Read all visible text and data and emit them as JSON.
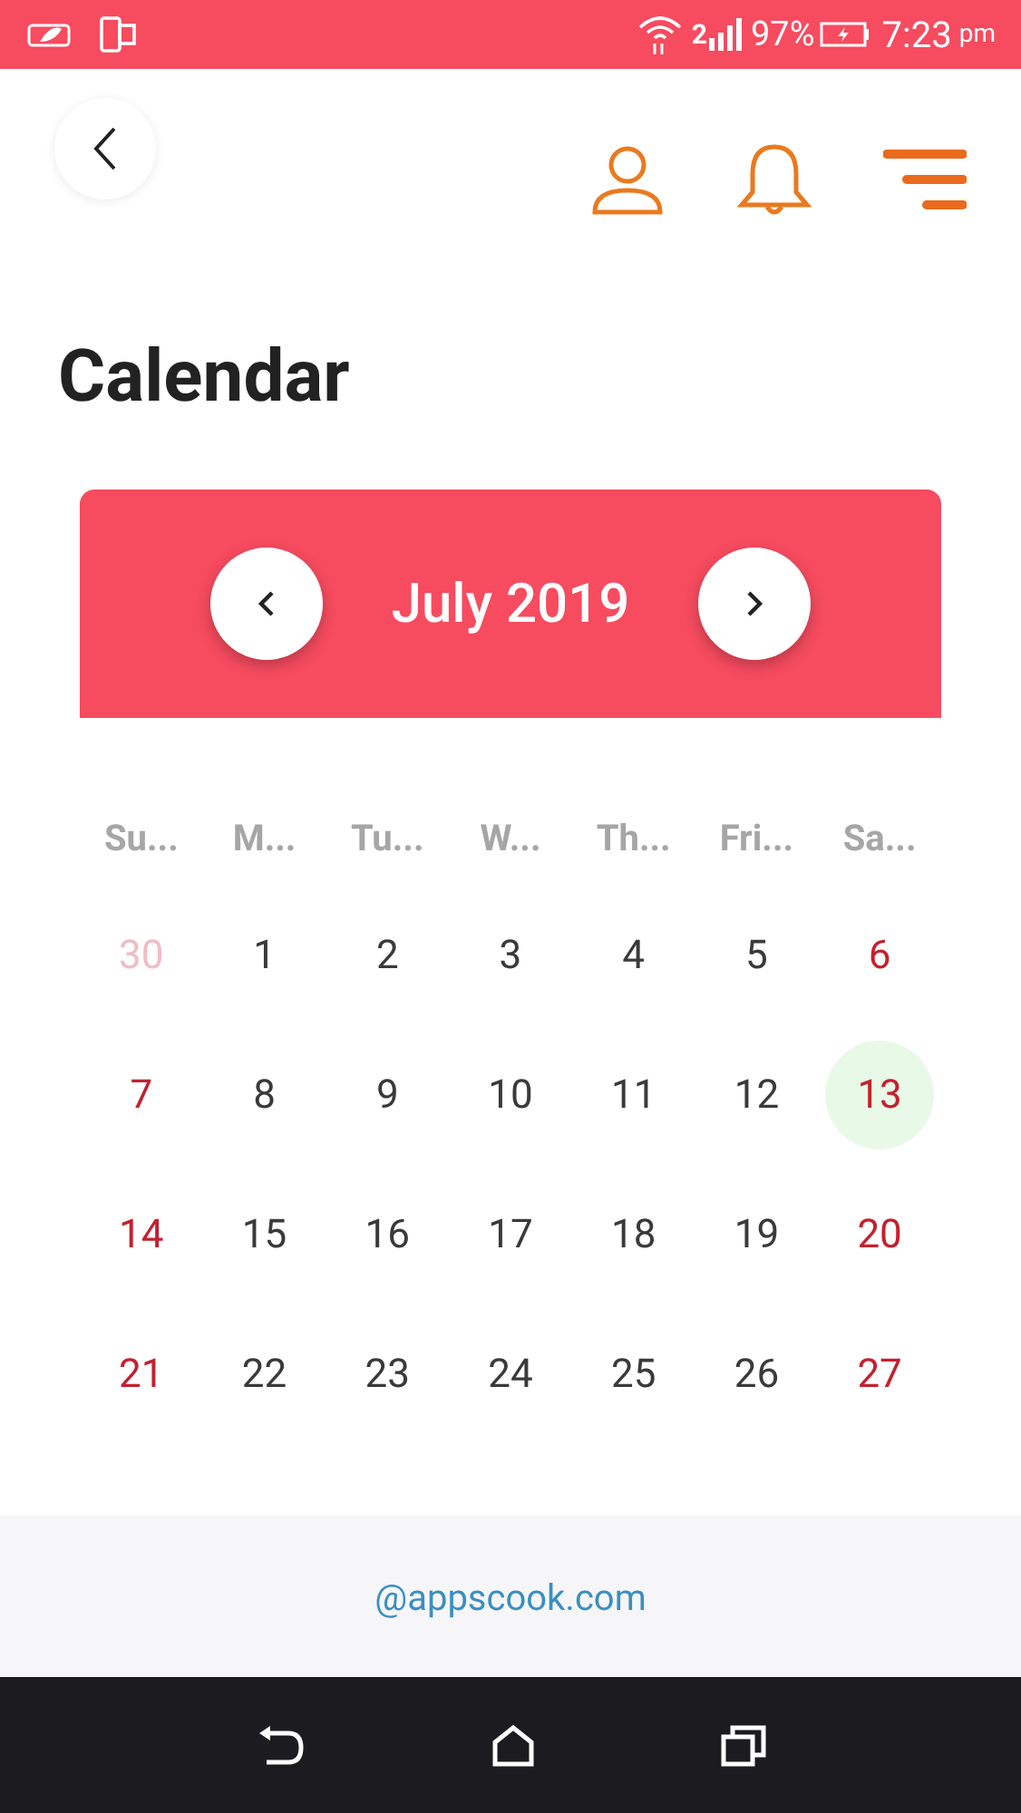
{
  "status_bar": {
    "network": "2",
    "battery": "97%",
    "time": "7:23",
    "ampm": "pm"
  },
  "page": {
    "title": "Calendar"
  },
  "calendar": {
    "month": "July 2019",
    "weekdays": [
      "Su...",
      "M...",
      "Tu...",
      "W...",
      "Th...",
      "Fri...",
      "Sa..."
    ],
    "days": [
      {
        "label": "30",
        "kind": "outside",
        "selected": false
      },
      {
        "label": "1",
        "kind": "weekday",
        "selected": false
      },
      {
        "label": "2",
        "kind": "weekday",
        "selected": false
      },
      {
        "label": "3",
        "kind": "weekday",
        "selected": false
      },
      {
        "label": "4",
        "kind": "weekday",
        "selected": false
      },
      {
        "label": "5",
        "kind": "weekday",
        "selected": false
      },
      {
        "label": "6",
        "kind": "weekend",
        "selected": false
      },
      {
        "label": "7",
        "kind": "weekend",
        "selected": false
      },
      {
        "label": "8",
        "kind": "weekday",
        "selected": false
      },
      {
        "label": "9",
        "kind": "weekday",
        "selected": false
      },
      {
        "label": "10",
        "kind": "weekday",
        "selected": false
      },
      {
        "label": "11",
        "kind": "weekday",
        "selected": false
      },
      {
        "label": "12",
        "kind": "weekday",
        "selected": false
      },
      {
        "label": "13",
        "kind": "weekend",
        "selected": true
      },
      {
        "label": "14",
        "kind": "weekend",
        "selected": false
      },
      {
        "label": "15",
        "kind": "weekday",
        "selected": false
      },
      {
        "label": "16",
        "kind": "weekday",
        "selected": false
      },
      {
        "label": "17",
        "kind": "weekday",
        "selected": false
      },
      {
        "label": "18",
        "kind": "weekday",
        "selected": false
      },
      {
        "label": "19",
        "kind": "weekday",
        "selected": false
      },
      {
        "label": "20",
        "kind": "weekend",
        "selected": false
      },
      {
        "label": "21",
        "kind": "weekend",
        "selected": false
      },
      {
        "label": "22",
        "kind": "weekday",
        "selected": false
      },
      {
        "label": "23",
        "kind": "weekday",
        "selected": false
      },
      {
        "label": "24",
        "kind": "weekday",
        "selected": false
      },
      {
        "label": "25",
        "kind": "weekday",
        "selected": false
      },
      {
        "label": "26",
        "kind": "weekday",
        "selected": false
      },
      {
        "label": "27",
        "kind": "weekend",
        "selected": false
      }
    ]
  },
  "footer": {
    "link": "@appscook.com"
  }
}
